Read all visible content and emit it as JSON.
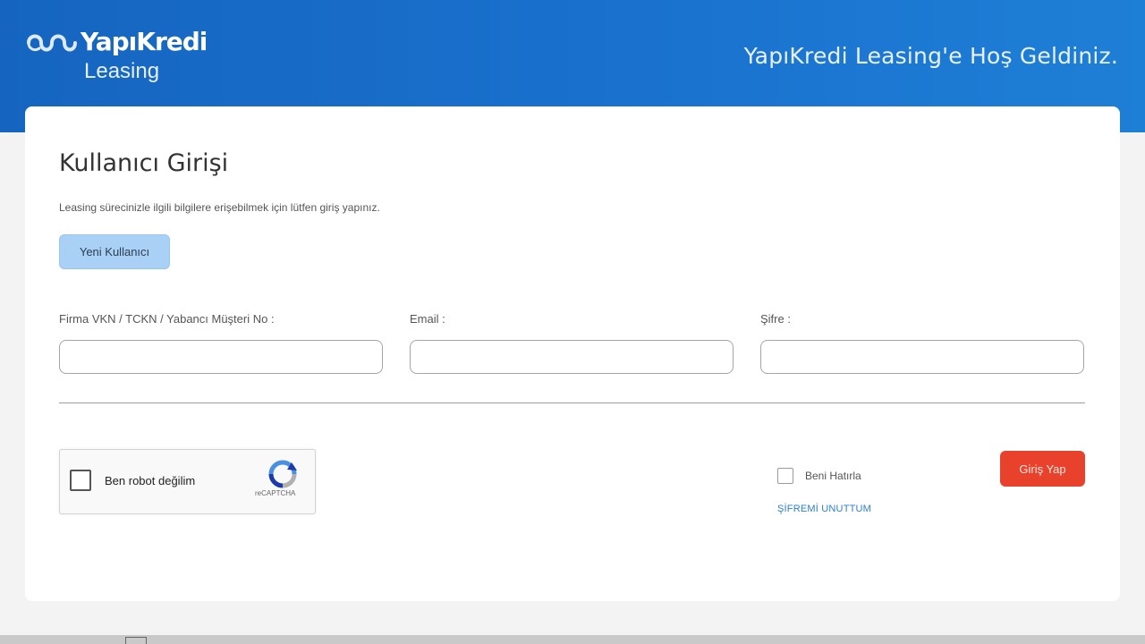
{
  "header": {
    "brand": "YapıKredi",
    "brand_sub": "Leasing",
    "welcome": "YapıKredi Leasing'e Hoş Geldiniz."
  },
  "login": {
    "title": "Kullanıcı Girişi",
    "subtitle": "Leasing sürecinizle ilgili bilgilere erişebilmek için lütfen giriş yapınız.",
    "new_user_label": "Yeni Kullanıcı",
    "fields": [
      {
        "label": "Firma VKN / TCKN / Yabancı Müşteri No :",
        "value": ""
      },
      {
        "label": "Email :",
        "value": ""
      },
      {
        "label": "Şifre :",
        "value": ""
      }
    ],
    "captcha": {
      "label": "Ben robot değilim",
      "brand": "reCAPTCHA"
    },
    "remember_label": "Beni Hatırla",
    "forgot_label": "ŞİFREMİ UNUTTUM",
    "submit_label": "Giriş Yap"
  },
  "colors": {
    "header_blue": "#1a73cf",
    "login_red": "#e8412c",
    "new_user_blue": "#a9d1f5",
    "link_blue": "#2b7fd1"
  },
  "icons": {
    "logo": "yapikredi-logo-icon",
    "captcha": "recaptcha-icon"
  }
}
